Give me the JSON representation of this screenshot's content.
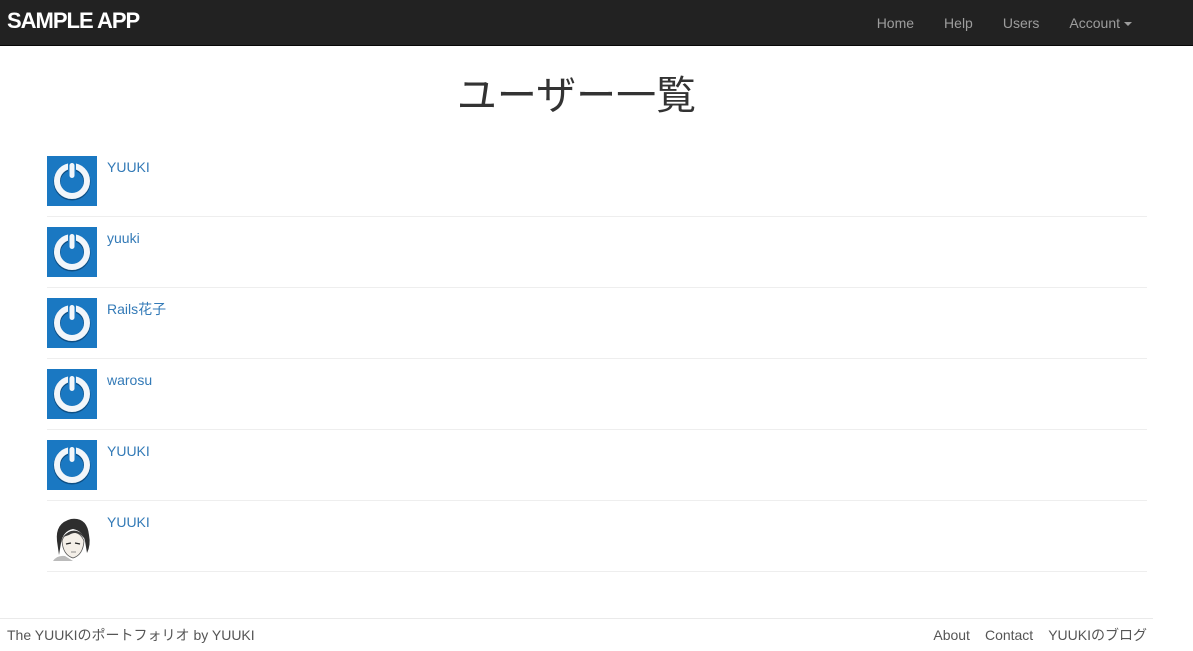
{
  "navbar": {
    "brand": "SAMPLE APP",
    "items": [
      {
        "label": "Home"
      },
      {
        "label": "Help"
      },
      {
        "label": "Users"
      },
      {
        "label": "Account"
      }
    ]
  },
  "main": {
    "title": "ユーザー一覧",
    "users": [
      {
        "name": "YUUKI",
        "avatar": "gravatar-default-icon"
      },
      {
        "name": "yuuki",
        "avatar": "gravatar-default-icon"
      },
      {
        "name": "Rails花子",
        "avatar": "gravatar-default-icon"
      },
      {
        "name": "warosu",
        "avatar": "gravatar-default-icon"
      },
      {
        "name": "YUUKI",
        "avatar": "gravatar-default-icon"
      },
      {
        "name": "YUUKI",
        "avatar": "custom-portrait-avatar"
      }
    ]
  },
  "footer": {
    "prefix": "The ",
    "portfolio_link": "YUUKIのポートフォリオ",
    "by": " by ",
    "author_link": "YUUKI",
    "links": [
      {
        "label": "About"
      },
      {
        "label": "Contact"
      },
      {
        "label": "YUUKIのブログ"
      }
    ]
  },
  "colors": {
    "navbar_bg": "#222222",
    "nav_link": "#9d9d9d",
    "link": "#337ab7",
    "gravatar_blue": "#1a78c2"
  }
}
